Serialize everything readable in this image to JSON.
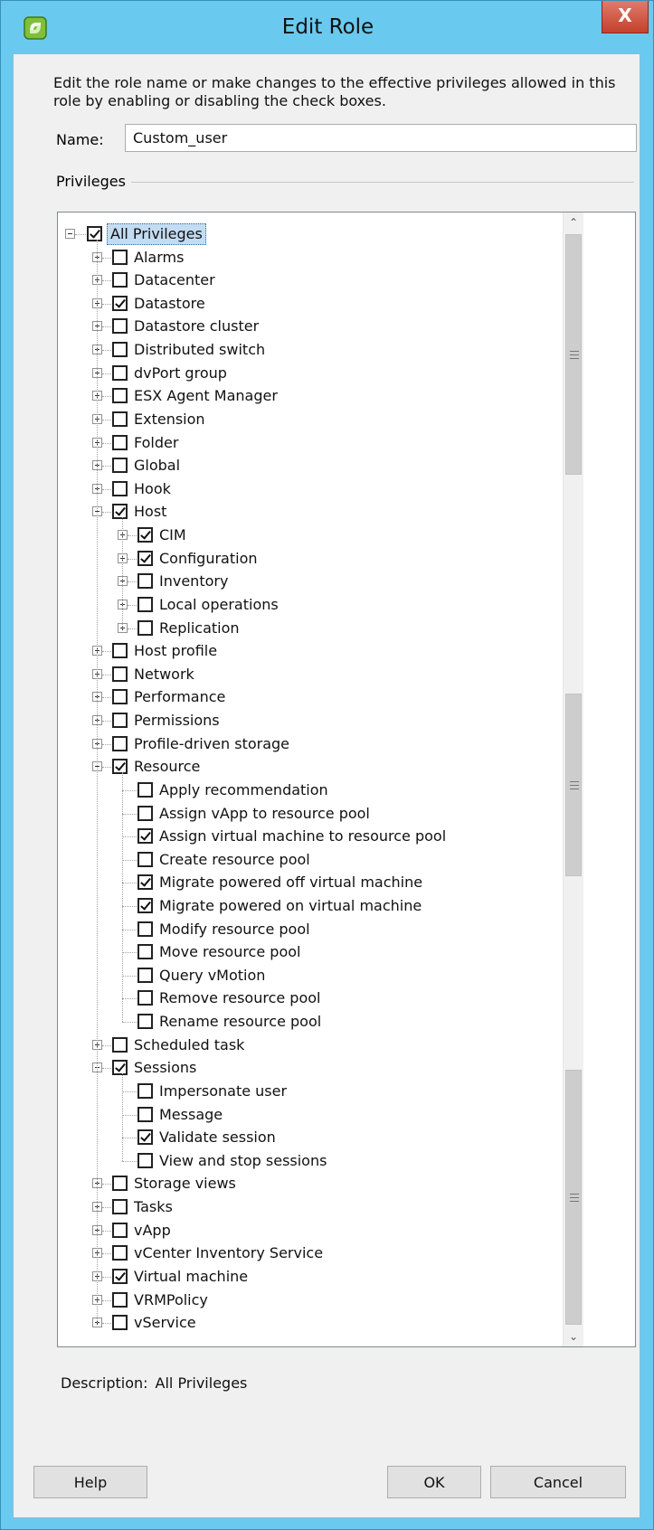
{
  "window": {
    "title": "Edit Role",
    "close_label": "X"
  },
  "intro": "Edit the role name or make changes to the effective privileges allowed in this role by enabling or disabling the check boxes.",
  "name_field": {
    "label": "Name:",
    "value": "Custom_user"
  },
  "privileges_label": "Privileges",
  "tree": [
    {
      "label": "All Privileges",
      "level": 0,
      "checked": true,
      "expander": "minus",
      "selected": true
    },
    {
      "label": "Alarms",
      "level": 1,
      "checked": false,
      "expander": "plus"
    },
    {
      "label": "Datacenter",
      "level": 1,
      "checked": false,
      "expander": "plus"
    },
    {
      "label": "Datastore",
      "level": 1,
      "checked": true,
      "expander": "plus"
    },
    {
      "label": "Datastore cluster",
      "level": 1,
      "checked": false,
      "expander": "plus"
    },
    {
      "label": "Distributed switch",
      "level": 1,
      "checked": false,
      "expander": "plus"
    },
    {
      "label": "dvPort group",
      "level": 1,
      "checked": false,
      "expander": "plus"
    },
    {
      "label": "ESX Agent Manager",
      "level": 1,
      "checked": false,
      "expander": "plus"
    },
    {
      "label": "Extension",
      "level": 1,
      "checked": false,
      "expander": "plus"
    },
    {
      "label": "Folder",
      "level": 1,
      "checked": false,
      "expander": "plus"
    },
    {
      "label": "Global",
      "level": 1,
      "checked": false,
      "expander": "plus"
    },
    {
      "label": "Hook",
      "level": 1,
      "checked": false,
      "expander": "plus"
    },
    {
      "label": "Host",
      "level": 1,
      "checked": true,
      "expander": "minus"
    },
    {
      "label": "CIM",
      "level": 2,
      "checked": true,
      "expander": "plus"
    },
    {
      "label": "Configuration",
      "level": 2,
      "checked": true,
      "expander": "plus"
    },
    {
      "label": "Inventory",
      "level": 2,
      "checked": false,
      "expander": "plus"
    },
    {
      "label": "Local operations",
      "level": 2,
      "checked": false,
      "expander": "plus"
    },
    {
      "label": "Replication",
      "level": 2,
      "checked": false,
      "expander": "plus"
    },
    {
      "label": "Host profile",
      "level": 1,
      "checked": false,
      "expander": "plus"
    },
    {
      "label": "Network",
      "level": 1,
      "checked": false,
      "expander": "plus"
    },
    {
      "label": "Performance",
      "level": 1,
      "checked": false,
      "expander": "plus"
    },
    {
      "label": "Permissions",
      "level": 1,
      "checked": false,
      "expander": "plus"
    },
    {
      "label": "Profile-driven storage",
      "level": 1,
      "checked": false,
      "expander": "plus"
    },
    {
      "label": "Resource",
      "level": 1,
      "checked": true,
      "expander": "minus"
    },
    {
      "label": "Apply recommendation",
      "level": 2,
      "checked": false,
      "expander": "none"
    },
    {
      "label": "Assign vApp to resource pool",
      "level": 2,
      "checked": false,
      "expander": "none"
    },
    {
      "label": "Assign virtual machine to resource pool",
      "level": 2,
      "checked": true,
      "expander": "none"
    },
    {
      "label": "Create resource pool",
      "level": 2,
      "checked": false,
      "expander": "none"
    },
    {
      "label": "Migrate powered off virtual machine",
      "level": 2,
      "checked": true,
      "expander": "none"
    },
    {
      "label": "Migrate powered on virtual machine",
      "level": 2,
      "checked": true,
      "expander": "none"
    },
    {
      "label": "Modify resource pool",
      "level": 2,
      "checked": false,
      "expander": "none"
    },
    {
      "label": "Move resource pool",
      "level": 2,
      "checked": false,
      "expander": "none"
    },
    {
      "label": "Query vMotion",
      "level": 2,
      "checked": false,
      "expander": "none"
    },
    {
      "label": "Remove resource pool",
      "level": 2,
      "checked": false,
      "expander": "none"
    },
    {
      "label": "Rename resource pool",
      "level": 2,
      "checked": false,
      "expander": "none"
    },
    {
      "label": "Scheduled task",
      "level": 1,
      "checked": false,
      "expander": "plus"
    },
    {
      "label": "Sessions",
      "level": 1,
      "checked": true,
      "expander": "minus"
    },
    {
      "label": "Impersonate user",
      "level": 2,
      "checked": false,
      "expander": "none"
    },
    {
      "label": "Message",
      "level": 2,
      "checked": false,
      "expander": "none"
    },
    {
      "label": "Validate session",
      "level": 2,
      "checked": true,
      "expander": "none"
    },
    {
      "label": "View and stop sessions",
      "level": 2,
      "checked": false,
      "expander": "none"
    },
    {
      "label": "Storage views",
      "level": 1,
      "checked": false,
      "expander": "plus"
    },
    {
      "label": "Tasks",
      "level": 1,
      "checked": false,
      "expander": "plus"
    },
    {
      "label": "vApp",
      "level": 1,
      "checked": false,
      "expander": "plus"
    },
    {
      "label": "vCenter Inventory Service",
      "level": 1,
      "checked": false,
      "expander": "plus"
    },
    {
      "label": "Virtual machine",
      "level": 1,
      "checked": true,
      "expander": "plus"
    },
    {
      "label": "VRMPolicy",
      "level": 1,
      "checked": false,
      "expander": "plus"
    },
    {
      "label": "vService",
      "level": 1,
      "checked": false,
      "expander": "plus"
    }
  ],
  "description": {
    "label": "Description:",
    "value": "All Privileges"
  },
  "buttons": {
    "help": "Help",
    "ok": "OK",
    "cancel": "Cancel"
  },
  "icons": {
    "app": "vsphere-role-icon",
    "close": "close-icon",
    "expander": "tree-expander-icon",
    "scroll_up": "scroll-up-icon",
    "scroll_down": "scroll-down-icon",
    "grip": "scroll-grip-icon"
  },
  "colors": {
    "title_bar": "#6ac9ef",
    "close_button": "#c4412c",
    "selection": "#c4dcf2",
    "dialog_bg": "#f0f0f0"
  }
}
